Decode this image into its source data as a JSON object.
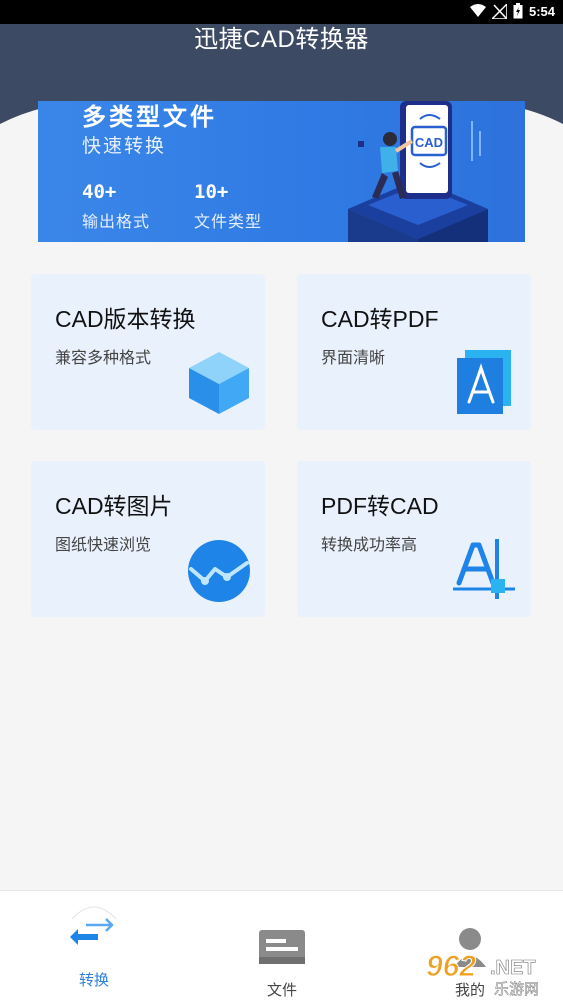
{
  "status_bar": {
    "time": "5:54",
    "icons": [
      "wifi-icon",
      "signal-icon",
      "battery-icon"
    ]
  },
  "header": {
    "title": "迅捷CAD转换器",
    "color": "#3d4a63"
  },
  "banner": {
    "headline": "多类型文件",
    "subtitle": "快速转换",
    "stats": [
      {
        "value": "40+",
        "label": "输出格式"
      },
      {
        "value": "10+",
        "label": "文件类型"
      }
    ],
    "badge_text": "CAD",
    "color": "#2f7be4"
  },
  "features": [
    {
      "title": "CAD版本转换",
      "desc": "兼容多种格式",
      "icon": "cube-icon"
    },
    {
      "title": "CAD转PDF",
      "desc": "界面清晰",
      "icon": "pdf-icon"
    },
    {
      "title": "CAD转图片",
      "desc": "图纸快速浏览",
      "icon": "chart-wave-icon"
    },
    {
      "title": "PDF转CAD",
      "desc": "转换成功率高",
      "icon": "text-cursor-icon"
    }
  ],
  "bottom_nav": {
    "items": [
      {
        "label": "转换",
        "icon": "convert-arrows-icon",
        "active": true
      },
      {
        "label": "文件",
        "icon": "file-folder-icon",
        "active": false
      },
      {
        "label": "我的",
        "icon": "user-profile-icon",
        "active": false
      }
    ],
    "active_color": "#2d7fe0"
  },
  "watermark": {
    "text": "962.NET",
    "subtext": "乐游网"
  }
}
